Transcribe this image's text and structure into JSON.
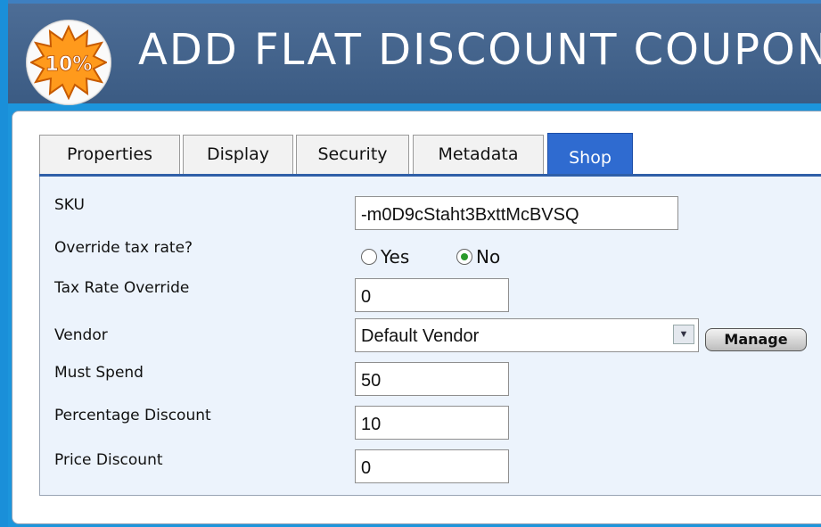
{
  "header": {
    "title": "ADD FLAT DISCOUNT COUPON",
    "logo_text": "10%"
  },
  "tabs": [
    {
      "label": "Properties"
    },
    {
      "label": "Display"
    },
    {
      "label": "Security"
    },
    {
      "label": "Metadata"
    },
    {
      "label": "Shop"
    }
  ],
  "form": {
    "sku": {
      "label": "SKU",
      "value": "-m0D9cStaht3BxttMcBVSQ"
    },
    "override_tax": {
      "label": "Override tax rate?",
      "options": [
        "Yes",
        "No"
      ],
      "selected": "No"
    },
    "tax_rate_override": {
      "label": "Tax Rate Override",
      "value": "0"
    },
    "vendor": {
      "label": "Vendor",
      "value": "Default Vendor",
      "button": "Manage"
    },
    "must_spend": {
      "label": "Must Spend",
      "value": "50"
    },
    "percentage_discount": {
      "label": "Percentage Discount",
      "value": "10"
    },
    "price_discount": {
      "label": "Price Discount",
      "value": "0"
    }
  },
  "colors": {
    "background_blue": "#1c95dc",
    "header": "#4a6a92",
    "active_tab": "#2f6bd0",
    "form_panel": "#ecf3fc",
    "logo_orange": "#ff9a1c"
  }
}
